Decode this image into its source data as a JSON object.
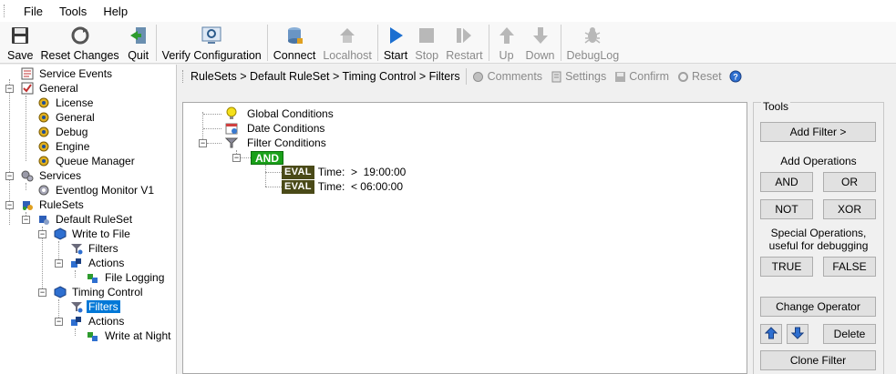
{
  "menu": {
    "items": [
      "File",
      "Tools",
      "Help"
    ]
  },
  "toolbar": {
    "save": "Save",
    "reset_changes": "Reset Changes",
    "quit": "Quit",
    "verify": "Verify Configuration",
    "connect": "Connect",
    "localhost": "Localhost",
    "start": "Start",
    "stop": "Stop",
    "restart": "Restart",
    "up": "Up",
    "down": "Down",
    "debuglog": "DebugLog"
  },
  "tree": {
    "service_events": "Service Events",
    "general": "General",
    "license": "License",
    "general_child": "General",
    "debug": "Debug",
    "engine": "Engine",
    "queue_manager": "Queue Manager",
    "services": "Services",
    "eventlog_monitor": "Eventlog Monitor V1",
    "rulesets": "RuleSets",
    "default_ruleset": "Default RuleSet",
    "write_to_file": "Write to File",
    "filters1": "Filters",
    "actions1": "Actions",
    "file_logging": "File Logging",
    "timing_control": "Timing Control",
    "filters2": "Filters",
    "actions2": "Actions",
    "write_at_night": "Write at Night"
  },
  "breadcrumb": {
    "path": "RuleSets > Default RuleSet > Timing Control > Filters",
    "comments": "Comments",
    "settings": "Settings",
    "confirm": "Confirm",
    "reset": "Reset"
  },
  "filters": {
    "global_conditions": "Global Conditions",
    "date_conditions": "Date Conditions",
    "filter_conditions": "Filter Conditions",
    "operator": "AND",
    "eval_label": "EVAL",
    "cond1": "Time:  >  19:00:00",
    "cond2": "Time:  < 06:00:00"
  },
  "tools": {
    "title": "Tools",
    "add_filter": "Add Filter >",
    "add_operations": "Add Operations",
    "and": "AND",
    "or": "OR",
    "not": "NOT",
    "xor": "XOR",
    "special_ops_line1": "Special Operations,",
    "special_ops_line2": "useful for debugging",
    "true": "TRUE",
    "false": "FALSE",
    "change_operator": "Change Operator",
    "delete": "Delete",
    "clone_filter": "Clone Filter"
  },
  "colors": {
    "selection": "#0078d7",
    "operator_green": "#1aa01a",
    "eval_olive": "#4a4a18",
    "start_blue": "#1c6fd0"
  }
}
